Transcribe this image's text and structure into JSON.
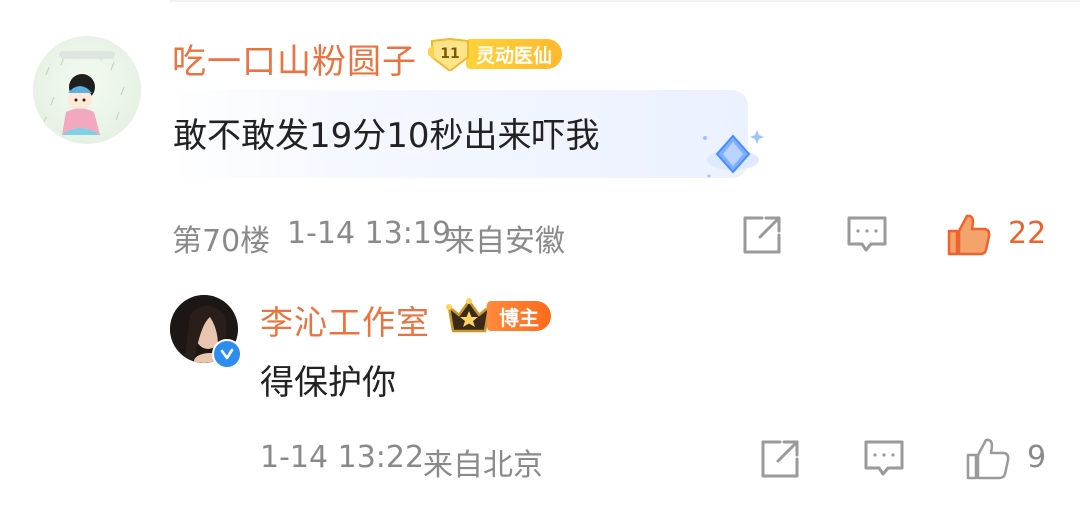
{
  "main_comment": {
    "author": "吃一口山粉圆子",
    "level": "11",
    "title_badge": "灵动医仙",
    "content": "敢不敢发19分10秒出来吓我",
    "floor": "第70楼",
    "timestamp": "1-14 13:19",
    "location": "来自安徽",
    "like_count": "22",
    "liked": true
  },
  "reply": {
    "author": "李沁工作室",
    "badge": "博主",
    "content": "得保护你",
    "timestamp": "1-14 13:22",
    "location": "来自北京",
    "like_count": "9",
    "liked": false
  },
  "colors": {
    "username": "#eb7340",
    "liked": "#f0612d",
    "meta": "#8a8a8a",
    "icon": "#9a9a9a"
  },
  "icons": {
    "share": "share-icon",
    "comment": "comment-icon",
    "like": "thumbs-up-icon",
    "verified": "verified-icon",
    "crown": "crown-icon",
    "bubble_decor": "diamond-icon"
  }
}
